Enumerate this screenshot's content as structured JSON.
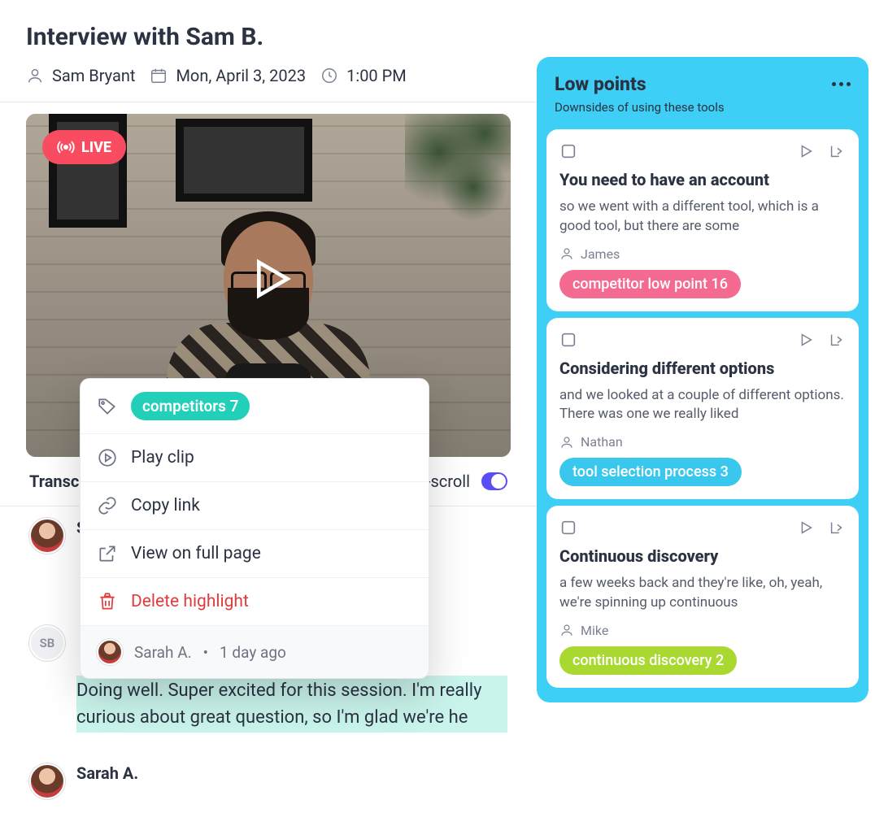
{
  "interview": {
    "title": "Interview with Sam B.",
    "participant": "Sam Bryant",
    "date": "Mon, April 3, 2023",
    "time": "1:00 PM",
    "live_label": "LIVE"
  },
  "transcript": {
    "tab_label": "Transcript",
    "autoscroll_label": "Auto-scroll",
    "speakers": {
      "sarah": "Sarah A.",
      "sam_initials": "SB"
    },
    "highlighted_text": "Doing well. Super excited for this session. I'm really curious about great question, so I'm glad we're he"
  },
  "context_menu": {
    "tag_label": "competitors 7",
    "play_label": "Play clip",
    "copy_label": "Copy link",
    "view_label": "View on full page",
    "delete_label": "Delete highlight",
    "footer_name": "Sarah A.",
    "footer_time": "1 day ago"
  },
  "side": {
    "title": "Low points",
    "subtitle": "Downsides of using these tools",
    "cards": [
      {
        "title": "You need to have an account",
        "body": "so we went with a different tool, which is a good tool, but there are some",
        "author": "James",
        "tag": "competitor low point 16",
        "tag_color": "pink"
      },
      {
        "title": "Considering different options",
        "body": "and we looked at a couple of different options. There was one we really liked",
        "author": "Nathan",
        "tag": "tool selection process 3",
        "tag_color": "cyan"
      },
      {
        "title": "Continuous discovery",
        "body": "a few weeks back and they're like, oh, yeah, we're spinning up continuous",
        "author": "Mike",
        "tag": "continuous discovery 2",
        "tag_color": "lime"
      }
    ]
  }
}
